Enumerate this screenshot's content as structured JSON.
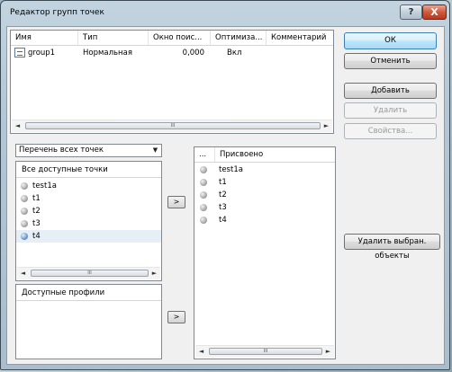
{
  "window": {
    "title": "Редактор групп точек",
    "help_label": "?",
    "close_label": "X"
  },
  "groups_table": {
    "columns": [
      "Имя",
      "Тип",
      "Окно поис...",
      "Оптимиза...",
      "Комментарий"
    ],
    "rows": [
      {
        "name": "group1",
        "type": "Нормальная",
        "window": "0,000",
        "optimization": "Вкл",
        "comment": ""
      }
    ]
  },
  "buttons": {
    "ok": "ОК",
    "cancel": "Отменить",
    "add": "Добавить",
    "delete": "Удалить",
    "properties": "Свойства...",
    "delete_selected": "Удалить выбран. объекты",
    "move_right_1": ">",
    "move_right_2": ">"
  },
  "points_filter": {
    "selected": "Перечень всех точек"
  },
  "available_points": {
    "header": "Все доступные точки",
    "items": [
      "test1a",
      "t1",
      "t2",
      "t3",
      "t4"
    ],
    "selected_index": 4
  },
  "available_profiles": {
    "header": "Доступные профили"
  },
  "assigned": {
    "col_dots": "...",
    "col_assigned": "Присвоено",
    "items": [
      "test1a",
      "t1",
      "t2",
      "t3",
      "t4"
    ]
  },
  "scrollbar": {
    "left_arrow": "◄",
    "right_arrow": "►",
    "thumb_grip": "III"
  },
  "icons": {
    "group_row": "group-icon",
    "point_dot": "point-dot-icon",
    "dropdown": "chevron-down-icon"
  }
}
